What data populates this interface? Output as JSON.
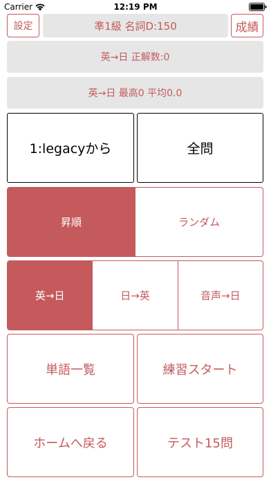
{
  "status_bar": {
    "carrier": "Carrier",
    "time": "12:19 PM",
    "icons": [
      "wifi-icon",
      "battery-icon"
    ]
  },
  "header": {
    "settings_label": "設定",
    "title": "準1級 名詞D:150",
    "results_label": "成績"
  },
  "info": {
    "correct_count": "英→日 正解数:0",
    "stats": "英→日 最高0 平均0.0"
  },
  "range": {
    "from_legacy": "1:legacyから",
    "all": "全問"
  },
  "order": {
    "options": [
      "昇順",
      "ランダム"
    ],
    "selected": "昇順"
  },
  "direction": {
    "options": [
      "英→日",
      "日→英",
      "音声→日"
    ],
    "selected": "英→日"
  },
  "actions": {
    "word_list": "単語一覧",
    "practice_start": "練習スタート",
    "back_home": "ホームへ戻る",
    "test_15": "テスト15問"
  },
  "colors": {
    "accent": "#c45a5c",
    "panel_gray": "#e6e6e6"
  }
}
